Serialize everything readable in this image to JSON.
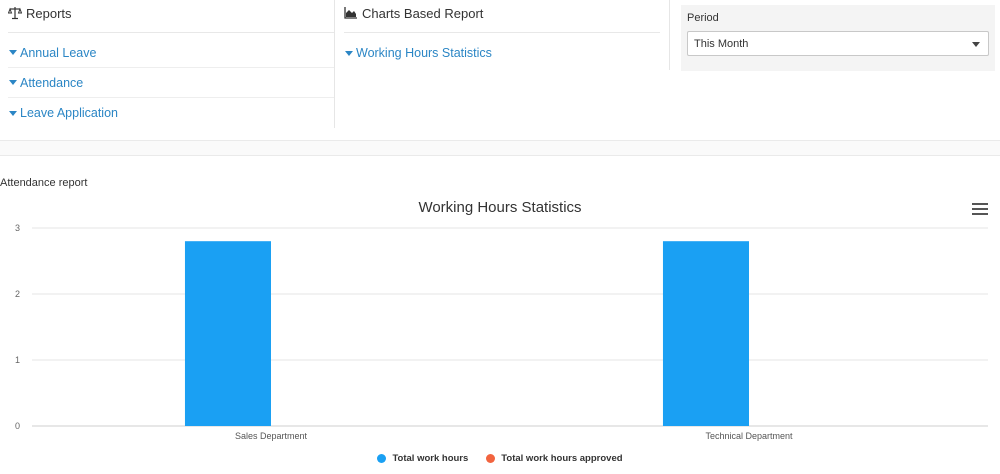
{
  "reports": {
    "title": "Reports",
    "icon": "balance-scale-icon",
    "links": [
      {
        "label": "Annual Leave"
      },
      {
        "label": "Attendance"
      },
      {
        "label": "Leave Application"
      }
    ]
  },
  "charts_report": {
    "title": "Charts Based Report",
    "icon": "area-chart-icon",
    "links": [
      {
        "label": "Working Hours Statistics"
      }
    ]
  },
  "period": {
    "label": "Period",
    "selected": "This Month"
  },
  "section": {
    "title": "Attendance report"
  },
  "colors": {
    "link": "#2b86c5",
    "series1": "#1aa0f3",
    "series2": "#f2643f"
  },
  "chart_data": {
    "type": "bar",
    "title": "Working Hours Statistics",
    "categories": [
      "Sales Department",
      "Technical Department"
    ],
    "series": [
      {
        "name": "Total work hours",
        "values": [
          2.8,
          2.8
        ]
      },
      {
        "name": "Total work hours approved",
        "values": [
          0,
          0
        ]
      }
    ],
    "ylim": [
      0,
      3
    ],
    "yticks": [
      "0",
      "1",
      "2",
      "3"
    ],
    "grid": true,
    "legend": "bottom-center",
    "menu_icon": "hamburger-menu-icon"
  }
}
